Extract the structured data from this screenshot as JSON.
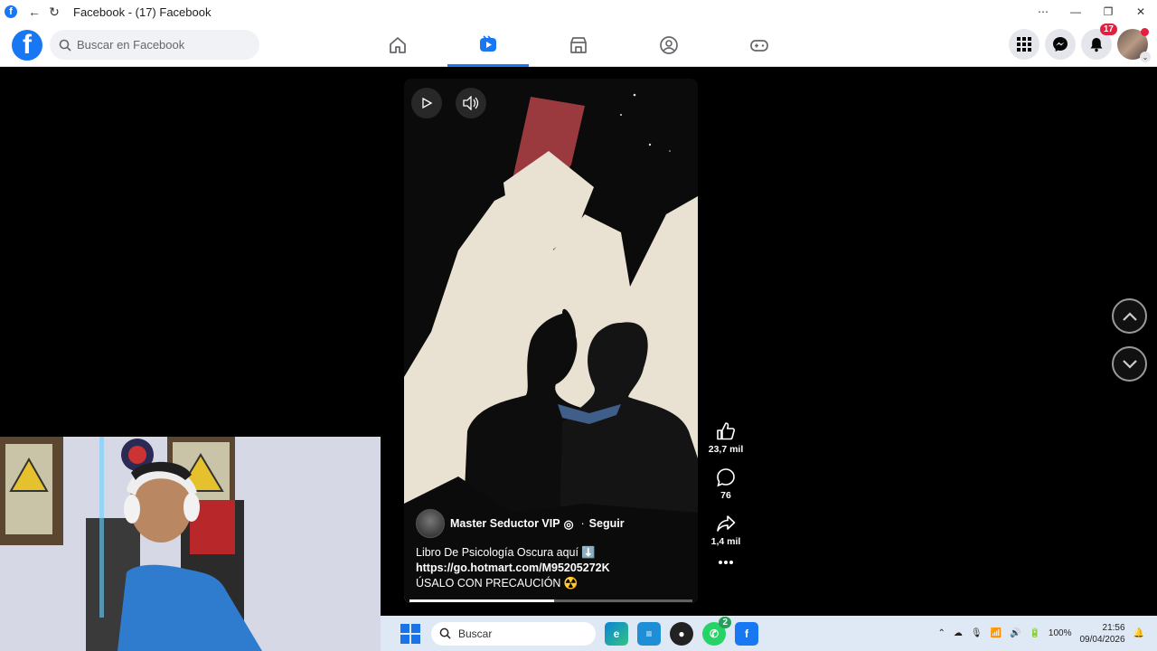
{
  "window": {
    "title": "Facebook - (17) Facebook"
  },
  "navbar": {
    "search_placeholder": "Buscar en Facebook",
    "tabs": [
      {
        "name": "home",
        "icon": "home-icon"
      },
      {
        "name": "video",
        "icon": "video-icon",
        "active": true
      },
      {
        "name": "marketplace",
        "icon": "marketplace-icon"
      },
      {
        "name": "groups",
        "icon": "groups-icon"
      },
      {
        "name": "gaming",
        "icon": "gaming-icon"
      }
    ],
    "notifications_count": "17",
    "accent": "#1877f2"
  },
  "reel": {
    "author": "Master Seductor VIP",
    "follow_label": "Seguir",
    "separator": "·",
    "caption_line1": "Libro De Psicología Oscura aquí ⬇️",
    "caption_link": "https://go.hotmart.com/M95205272K",
    "caption_line3": "ÚSALO CON PRECAUCIÓN ☢️",
    "progress": 0.51
  },
  "actions": {
    "likes": "23,7 mil",
    "comments": "76",
    "shares": "1,4 mil"
  },
  "taskbar": {
    "search_label": "Buscar",
    "whatsapp_badge": "2",
    "battery": "100%",
    "time": "21:56",
    "date": "09/04/2026"
  }
}
